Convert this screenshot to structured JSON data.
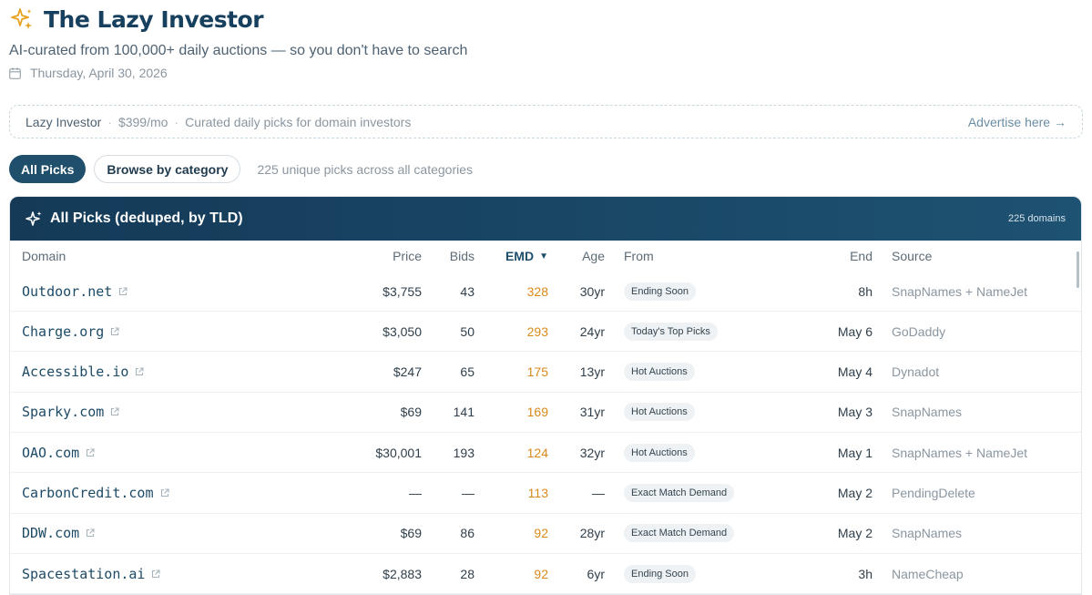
{
  "app": {
    "title": "The Lazy Investor",
    "tagline": "AI-curated from 100,000+ daily auctions — so you don't have to search",
    "date": "Thursday, April 30, 2026"
  },
  "ad": {
    "brand": "Lazy Investor",
    "price": "$399/mo",
    "description": "Curated daily picks for domain investors",
    "link": "Advertise here →"
  },
  "filters": {
    "all_picks": "All Picks",
    "browse": "Browse by category",
    "note": "225 unique picks across all categories"
  },
  "table": {
    "title": "All Picks (deduped, by TLD)",
    "count": "225 domains",
    "columns": {
      "domain": "Domain",
      "price": "Price",
      "bids": "Bids",
      "emd": "EMD",
      "age": "Age",
      "from": "From",
      "end": "End",
      "source": "Source"
    },
    "rows": [
      {
        "domain": "Outdoor.net",
        "price": "$3,755",
        "bids": "43",
        "emd": "328",
        "age": "30yr",
        "from": "Ending Soon",
        "end": "8h",
        "source": "SnapNames + NameJet"
      },
      {
        "domain": "Charge.org",
        "price": "$3,050",
        "bids": "50",
        "emd": "293",
        "age": "24yr",
        "from": "Today's Top Picks",
        "end": "May 6",
        "source": "GoDaddy"
      },
      {
        "domain": "Accessible.io",
        "price": "$247",
        "bids": "65",
        "emd": "175",
        "age": "13yr",
        "from": "Hot Auctions",
        "end": "May 4",
        "source": "Dynadot"
      },
      {
        "domain": "Sparky.com",
        "price": "$69",
        "bids": "141",
        "emd": "169",
        "age": "31yr",
        "from": "Hot Auctions",
        "end": "May 3",
        "source": "SnapNames"
      },
      {
        "domain": "OAO.com",
        "price": "$30,001",
        "bids": "193",
        "emd": "124",
        "age": "32yr",
        "from": "Hot Auctions",
        "end": "May 1",
        "source": "SnapNames + NameJet"
      },
      {
        "domain": "CarbonCredit.com",
        "price": "—",
        "bids": "—",
        "emd": "113",
        "age": "—",
        "from": "Exact Match Demand",
        "end": "May 2",
        "source": "PendingDelete"
      },
      {
        "domain": "DDW.com",
        "price": "$69",
        "bids": "86",
        "emd": "92",
        "age": "28yr",
        "from": "Exact Match Demand",
        "end": "May 2",
        "source": "SnapNames"
      },
      {
        "domain": "Spacestation.ai",
        "price": "$2,883",
        "bids": "28",
        "emd": "92",
        "age": "6yr",
        "from": "Ending Soon",
        "end": "3h",
        "source": "NameCheap"
      }
    ]
  },
  "icons": {
    "logo": "sparkle-icon",
    "date": "calendar-icon",
    "card": "sparkle-icon",
    "external": "external-link-icon"
  },
  "colors": {
    "brand": "#17405e",
    "accent": "#1f4f6b",
    "emd": "#d98a1a"
  }
}
